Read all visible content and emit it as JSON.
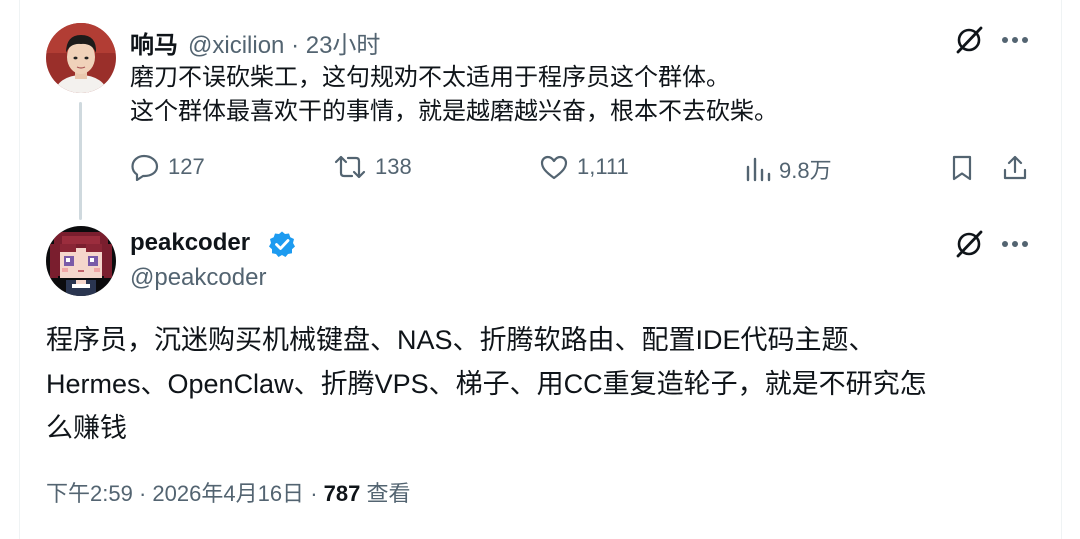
{
  "reply": {
    "author_name": "响马",
    "handle": "@xicilion",
    "separator": "·",
    "time": "23小时",
    "lines": [
      "磨刀不误砍柴工，这句规劝不太适用于程序员这个群体。",
      "这个群体最喜欢干的事情，就是越磨越兴奋，根本不去砍柴。"
    ],
    "actions": {
      "replies": "127",
      "retweets": "138",
      "likes": "1,111",
      "views": "9.8万"
    }
  },
  "main": {
    "author_name": "peakcoder",
    "handle": "@peakcoder",
    "verified": true,
    "lines": [
      "程序员，沉迷购买机械键盘、NAS、折腾软路由、配置IDE代码主题、",
      "Hermes、OpenClaw、折腾VPS、梯子、用CC重复造轮子，就是不研究怎",
      "么赚钱"
    ],
    "footer": {
      "time": "下午2:59",
      "separator": "·",
      "date": "2026年4月16日",
      "separator2": "·",
      "views_count": "787",
      "views_label": "查看"
    }
  },
  "colors": {
    "text": "#0f1419",
    "secondary": "#536471",
    "verified": "#1d9bf0",
    "thread_line": "#cfd9de",
    "border": "#eff3f4"
  },
  "icons": {
    "grok": "grok-icon",
    "more": "more-icon",
    "reply": "reply-icon",
    "retweet": "retweet-icon",
    "like": "like-icon",
    "views": "views-icon",
    "bookmark": "bookmark-icon",
    "share": "share-icon",
    "verified": "verified-badge-icon"
  }
}
